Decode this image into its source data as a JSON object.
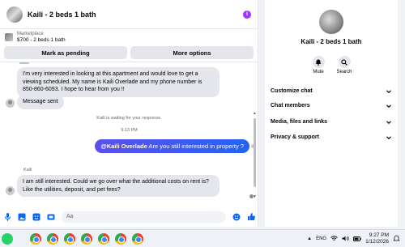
{
  "chat": {
    "title": "Kaili - 2 beds 1 bath",
    "marketplace_source": "Marketplace",
    "marketplace_item": "$700 - 2 beds 1 bath",
    "buttons": {
      "pending": "Mark as pending",
      "more": "More options"
    }
  },
  "messages": {
    "first": "I'm very interested in looking at this apartment and would love to get a viewing scheduled. My name is Kaili Overlade and my phone number is 850-860-6093. I hope to hear from you !!",
    "sent": "Message sent",
    "waiting": "Kaili is waiting for your response.",
    "time": "9:13 PM",
    "outgoing_mention": "@Kaili Overlade",
    "outgoing_text": " Are you still interested in property ?",
    "sender_name": "Kaili",
    "reply": "I am still interested. Could we go over what the additional costs on rent is? Like the utilities, deposit, and pet fees?"
  },
  "composer": {
    "placeholder": "Aa"
  },
  "info": {
    "title": "Kaili - 2 beds 1 bath",
    "mute": "Mute",
    "search": "Search",
    "sections": [
      "Customize chat",
      "Chat members",
      "Media, files and links",
      "Privacy & support"
    ]
  },
  "taskbar": {
    "lang": "ENG",
    "time": "9:27 PM",
    "date": "1/12/2026"
  },
  "colors": {
    "accent": "#0a7cff",
    "info": "#a033ff"
  }
}
